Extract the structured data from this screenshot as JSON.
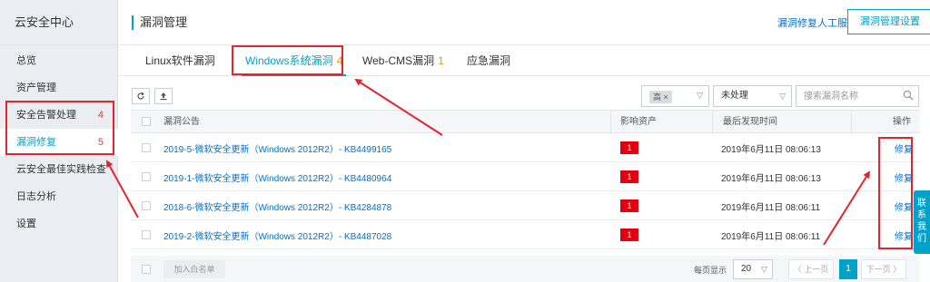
{
  "sidebar": {
    "brand": "云安全中心",
    "items": [
      {
        "label": "总览",
        "count": ""
      },
      {
        "label": "资产管理",
        "count": ""
      },
      {
        "label": "安全告警处理",
        "count": "4"
      },
      {
        "label": "漏洞修复",
        "count": "5"
      },
      {
        "label": "云安全最佳实践检查",
        "count": ""
      },
      {
        "label": "日志分析",
        "count": ""
      },
      {
        "label": "设置",
        "count": ""
      }
    ]
  },
  "header": {
    "title": "漏洞管理",
    "service_link": "漏洞修复人工服务",
    "settings_button": "漏洞管理设置"
  },
  "tabs": [
    {
      "label": "Linux软件漏洞",
      "count": ""
    },
    {
      "label": "Windows系统漏洞",
      "count": "4"
    },
    {
      "label": "Web-CMS漏洞",
      "count": "1"
    },
    {
      "label": "应急漏洞",
      "count": ""
    }
  ],
  "toolbar": {
    "refresh_icon": "refresh-icon",
    "export_icon": "upload-icon",
    "level_tag": "高",
    "level_tag_close": "×",
    "status_value": "未处理",
    "search_placeholder": "搜索漏洞名称"
  },
  "table": {
    "headers": {
      "name": "漏洞公告",
      "assets": "影响资产",
      "last_found": "最后发现时间",
      "action": "操作"
    },
    "rows": [
      {
        "name": "2019-5-微软安全更新（Windows 2012R2）- KB4499165",
        "assets": "1",
        "last_found": "2019年6月11日 08:06:13",
        "action": "修复"
      },
      {
        "name": "2019-1-微软安全更新（Windows 2012R2）- KB4480964",
        "assets": "1",
        "last_found": "2019年6月11日 08:06:13",
        "action": "修复"
      },
      {
        "name": "2018-6-微软安全更新（Windows 2012R2）- KB4284878",
        "assets": "1",
        "last_found": "2019年6月11日 08:06:11",
        "action": "修复"
      },
      {
        "name": "2019-2-微软安全更新（Windows 2012R2）- KB4487028",
        "assets": "1",
        "last_found": "2019年6月11日 08:06:11",
        "action": "修复"
      }
    ]
  },
  "footer": {
    "whitelist_button": "加入白名单",
    "per_page_label": "每页显示",
    "per_page_value": "20",
    "prev": "〈 上一页",
    "current_page": "1",
    "next": "下一页 〉"
  },
  "contact": [
    "联",
    "系",
    "我",
    "们"
  ],
  "colors": {
    "accent": "#00a2ca",
    "link": "#0070cc",
    "annotation": "#e3262e",
    "badge": "#e00012",
    "count": "#f39800"
  }
}
